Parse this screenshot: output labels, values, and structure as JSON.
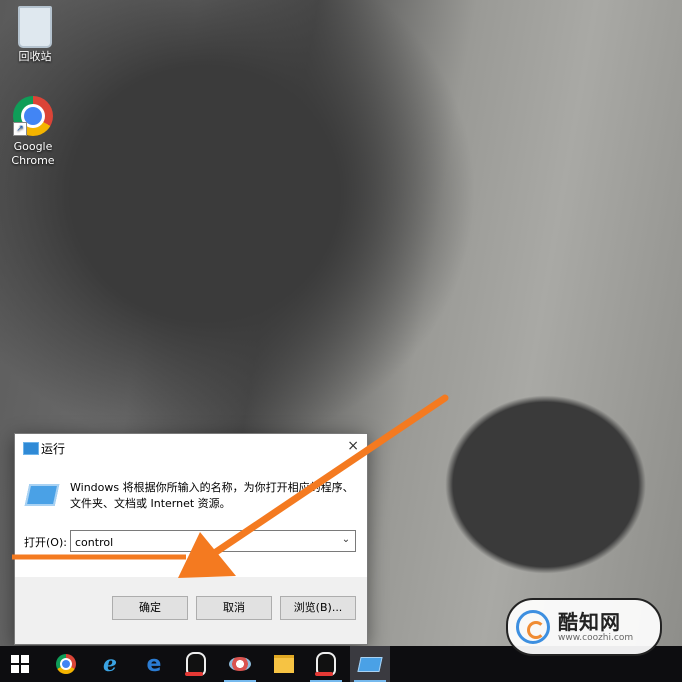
{
  "desktop": {
    "icons": [
      {
        "label": "回收站"
      },
      {
        "label_line1": "Google",
        "label_line2": "Chrome"
      }
    ]
  },
  "run_dialog": {
    "title": "运行",
    "close": "×",
    "description": "Windows 将根据你所输入的名称，为你打开相应的程序、文件夹、文档或 Internet 资源。",
    "open_label": "打开(O):",
    "input_value": "control",
    "buttons": {
      "ok": "确定",
      "cancel": "取消",
      "browse": "浏览(B)..."
    }
  },
  "taskbar": {
    "items": [
      "start-button",
      "chrome",
      "internet-explorer",
      "edge",
      "qq",
      "app",
      "file-explorer",
      "qq",
      "run"
    ]
  },
  "annotation": {
    "arrow_color": "#f47a20"
  },
  "watermark": {
    "name": "酷知网",
    "url": "www.coozhi.com"
  }
}
